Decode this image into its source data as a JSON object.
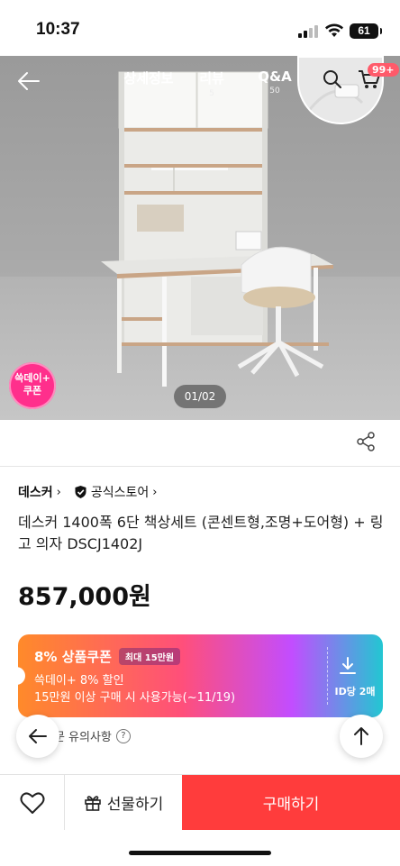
{
  "status_bar": {
    "time": "10:37",
    "battery": "61"
  },
  "header": {
    "tabs": [
      {
        "label": "상세정보",
        "count": ""
      },
      {
        "label": "리뷰",
        "count": "5"
      },
      {
        "label": "Q&A",
        "count": "50"
      }
    ],
    "cart_badge": "99+"
  },
  "gallery": {
    "page_indicator": "01/02",
    "sticker_line1": "쓱데이+",
    "sticker_line2": "쿠폰"
  },
  "brand": {
    "name": "데스커",
    "store_label": "공식스토어"
  },
  "product": {
    "title": "데스커 1400폭 6단 책상세트 (콘센트형,조명+도어형) + 링고 의자 DSCJ1402J",
    "price": "857,000원"
  },
  "coupon": {
    "title": "8% 상품쿠폰",
    "max_label": "최대 15만원",
    "line1": "쓱데이+ 8% 할인",
    "line2": "15만원 이상 구매 시 사용가능(~11/19)",
    "limit": "ID당 2매"
  },
  "notice": {
    "label": "주문 유의사항"
  },
  "bottom_bar": {
    "gift_label": "선물하기",
    "buy_label": "구매하기"
  },
  "colors": {
    "buy": "#ff3c3c",
    "coupon_start": "#ff8a2a",
    "coupon_end": "#22c7d2",
    "badge": "#ff5a6a"
  }
}
